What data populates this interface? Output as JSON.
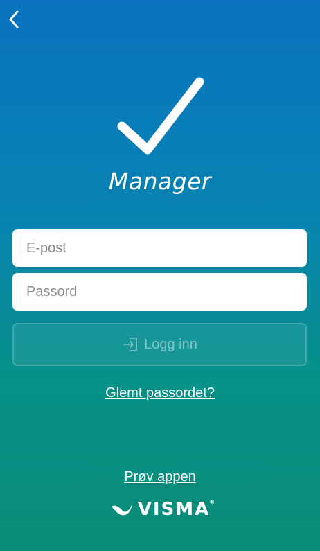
{
  "nav": {
    "back_icon": "chevron-left-icon"
  },
  "logo": {
    "icon": "checkmark-icon"
  },
  "app": {
    "title": "Manager"
  },
  "form": {
    "email_placeholder": "E-post",
    "email_value": "",
    "password_placeholder": "Passord",
    "password_value": "",
    "login_label": "Logg inn",
    "login_icon": "login-arrow-icon"
  },
  "links": {
    "forgot_password": "Glemt passordet?",
    "try_app": "Prøv appen"
  },
  "brand": {
    "name": "VISMA",
    "mark": "®",
    "logo_icon": "visma-swoosh-icon"
  },
  "colors": {
    "gradient_top": "#0a72bf",
    "gradient_bottom": "#0a8c78",
    "field_bg": "#ffffff",
    "placeholder": "#8a8a8a"
  }
}
